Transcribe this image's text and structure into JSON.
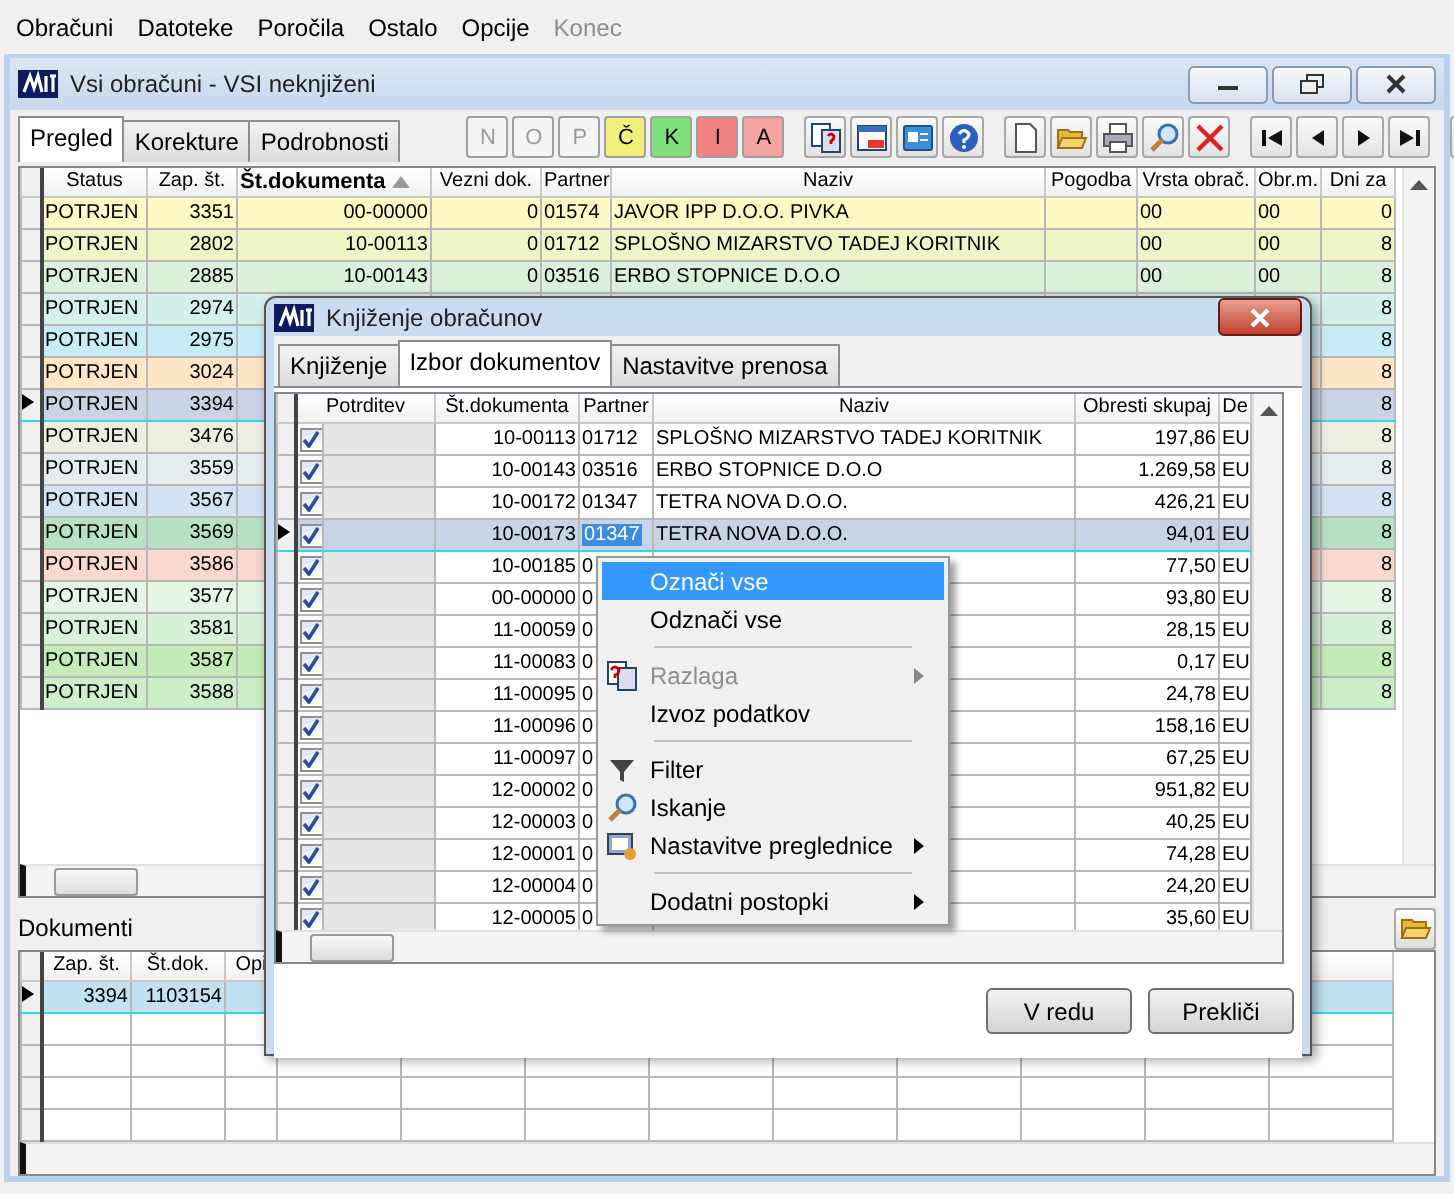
{
  "menubar": [
    {
      "label": "Obračuni",
      "disabled": false
    },
    {
      "label": "Datoteke",
      "disabled": false
    },
    {
      "label": "Poročila",
      "disabled": false
    },
    {
      "label": "Ostalo",
      "disabled": false
    },
    {
      "label": "Opcije",
      "disabled": false
    },
    {
      "label": "Konec",
      "disabled": true
    }
  ],
  "window": {
    "title": "Vsi obračuni - VSI neknjiženi"
  },
  "tabs": [
    {
      "label": "Pregled",
      "selected": true
    },
    {
      "label": "Korekture",
      "selected": false
    },
    {
      "label": "Podrobnosti",
      "selected": false
    }
  ],
  "filter_buttons": [
    {
      "label": "N",
      "disabled": true,
      "color": "#f4f4f4"
    },
    {
      "label": "O",
      "disabled": true,
      "color": "#f4f4f4"
    },
    {
      "label": "P",
      "disabled": true,
      "color": "#f4f4f4"
    },
    {
      "label": "Č",
      "disabled": false,
      "color": "#f2f07a"
    },
    {
      "label": "K",
      "disabled": false,
      "color": "#80e080"
    },
    {
      "label": "I",
      "disabled": false,
      "color": "#f08282"
    },
    {
      "label": "A",
      "disabled": false,
      "color": "#f4a4a0"
    }
  ],
  "grid": {
    "columns": [
      {
        "label": "Status",
        "sorted": false
      },
      {
        "label": "Zap. št.",
        "sorted": false
      },
      {
        "label": "Št.dokumenta",
        "sorted": true
      },
      {
        "label": "Vezni dok.",
        "sorted": false
      },
      {
        "label": "Partner",
        "sorted": false
      },
      {
        "label": "Naziv",
        "sorted": false
      },
      {
        "label": "Pogodba",
        "sorted": false
      },
      {
        "label": "Vrsta obrač.",
        "sorted": false
      },
      {
        "label": "Obr.m.",
        "sorted": false
      },
      {
        "label": "Dni za",
        "sorted": false
      }
    ],
    "rows": [
      {
        "cells": [
          "POTRJEN",
          "3351",
          "00-00000",
          "0",
          "01574",
          "JAVOR IPP  D.O.O. PIVKA",
          "",
          "00",
          "00",
          "0"
        ],
        "color": "#fdf8c4",
        "selected": false
      },
      {
        "cells": [
          "POTRJEN",
          "2802",
          "10-00113",
          "0",
          "01712",
          "SPLOŠNO MIZARSTVO TADEJ KORITNIK",
          "",
          "00",
          "00",
          "8"
        ],
        "color": "#eef6c8",
        "selected": false
      },
      {
        "cells": [
          "POTRJEN",
          "2885",
          "10-00143",
          "0",
          "03516",
          "ERBO STOPNICE D.O.O",
          "",
          "00",
          "00",
          "8"
        ],
        "color": "#daf2da",
        "selected": false
      },
      {
        "cells": [
          "POTRJEN",
          "2974",
          "",
          "",
          "",
          "",
          "",
          "",
          "",
          "8"
        ],
        "color": "#d4f0ea",
        "selected": false
      },
      {
        "cells": [
          "POTRJEN",
          "2975",
          "",
          "",
          "",
          "",
          "",
          "",
          "",
          "8"
        ],
        "color": "#c8ecf6",
        "selected": false
      },
      {
        "cells": [
          "POTRJEN",
          "3024",
          "",
          "",
          "",
          "",
          "",
          "",
          "",
          "8"
        ],
        "color": "#fde6c6",
        "selected": false
      },
      {
        "cells": [
          "POTRJEN",
          "3394",
          "",
          "",
          "",
          "",
          "",
          "",
          "",
          "8"
        ],
        "color": "#c8d4e6",
        "selected": true
      },
      {
        "cells": [
          "POTRJEN",
          "3476",
          "",
          "",
          "",
          "",
          "",
          "",
          "",
          "8"
        ],
        "color": "#eeeee0",
        "selected": false
      },
      {
        "cells": [
          "POTRJEN",
          "3559",
          "",
          "",
          "",
          "",
          "",
          "",
          "",
          "8"
        ],
        "color": "#e4ecee",
        "selected": false
      },
      {
        "cells": [
          "POTRJEN",
          "3567",
          "",
          "",
          "",
          "",
          "",
          "",
          "",
          "8"
        ],
        "color": "#d2e4f4",
        "selected": false
      },
      {
        "cells": [
          "POTRJEN",
          "3569",
          "",
          "",
          "",
          "",
          "",
          "",
          "",
          "8"
        ],
        "color": "#b8e0c2",
        "selected": false
      },
      {
        "cells": [
          "POTRJEN",
          "3586",
          "",
          "",
          "",
          "",
          "",
          "",
          "",
          "8"
        ],
        "color": "#f9d8ce",
        "selected": false
      },
      {
        "cells": [
          "POTRJEN",
          "3577",
          "",
          "",
          "",
          "",
          "",
          "",
          "",
          "8"
        ],
        "color": "#e4f6e4",
        "selected": false
      },
      {
        "cells": [
          "POTRJEN",
          "3581",
          "",
          "",
          "",
          "",
          "",
          "",
          "",
          "8"
        ],
        "color": "#d8f2d8",
        "selected": false
      },
      {
        "cells": [
          "POTRJEN",
          "3587",
          "",
          "",
          "",
          "",
          "",
          "",
          "",
          "8"
        ],
        "color": "#c4ecb8",
        "selected": false
      },
      {
        "cells": [
          "POTRJEN",
          "3588",
          "",
          "",
          "",
          "",
          "",
          "",
          "",
          "8"
        ],
        "color": "#cceec8",
        "selected": false
      }
    ]
  },
  "documents": {
    "title": "Dokumenti",
    "columns": [
      "Zap. št.",
      "Št.dok.",
      "Opi"
    ],
    "rows": [
      {
        "cells": [
          "3394",
          "1103154"
        ],
        "selected": true
      }
    ]
  },
  "dialog": {
    "title": "Knjiženje obračunov",
    "tabs": [
      {
        "label": "Knjiženje",
        "selected": false
      },
      {
        "label": "Izbor dokumentov",
        "selected": true
      },
      {
        "label": "Nastavitve prenosa",
        "selected": false
      }
    ],
    "check_column": "Potrditev",
    "columns": [
      "Št.dokumenta",
      "Partner",
      "Naziv",
      "Obresti skupaj",
      "De"
    ],
    "rows": [
      {
        "checked": true,
        "cells": [
          "10-00113",
          "01712",
          "SPLOŠNO MIZARSTVO TADEJ KORITNIK",
          "197,86",
          "EU"
        ],
        "selected": false
      },
      {
        "checked": true,
        "cells": [
          "10-00143",
          "03516",
          "ERBO STOPNICE D.O.O",
          "1.269,58",
          "EU"
        ],
        "selected": false
      },
      {
        "checked": true,
        "cells": [
          "10-00172",
          "01347",
          "TETRA NOVA D.O.O.",
          "426,21",
          "EU"
        ],
        "selected": false
      },
      {
        "checked": true,
        "cells": [
          "10-00173",
          "01347",
          "TETRA NOVA D.O.O.",
          "94,01",
          "EU"
        ],
        "selected": true
      },
      {
        "checked": true,
        "cells": [
          "10-00185",
          "0",
          "",
          "77,50",
          "EU"
        ],
        "selected": false
      },
      {
        "checked": true,
        "cells": [
          "00-00000",
          "0",
          "",
          "93,80",
          "EU"
        ],
        "selected": false
      },
      {
        "checked": true,
        "cells": [
          "11-00059",
          "0",
          "",
          "28,15",
          "EU"
        ],
        "selected": false
      },
      {
        "checked": true,
        "cells": [
          "11-00083",
          "0",
          "",
          "0,17",
          "EU"
        ],
        "selected": false
      },
      {
        "checked": true,
        "cells": [
          "11-00095",
          "0",
          "",
          "24,78",
          "EU"
        ],
        "selected": false
      },
      {
        "checked": true,
        "cells": [
          "11-00096",
          "0",
          "",
          "158,16",
          "EU"
        ],
        "selected": false
      },
      {
        "checked": true,
        "cells": [
          "11-00097",
          "0",
          "",
          "67,25",
          "EU"
        ],
        "selected": false
      },
      {
        "checked": true,
        "cells": [
          "12-00002",
          "0",
          "",
          "951,82",
          "EU"
        ],
        "selected": false
      },
      {
        "checked": true,
        "cells": [
          "12-00003",
          "0",
          "",
          "40,25",
          "EU"
        ],
        "selected": false
      },
      {
        "checked": true,
        "cells": [
          "12-00001",
          "0",
          "",
          "74,28",
          "EU"
        ],
        "selected": false
      },
      {
        "checked": true,
        "cells": [
          "12-00004",
          "0",
          "",
          "24,20",
          "EU"
        ],
        "selected": false
      },
      {
        "checked": true,
        "cells": [
          "12-00005",
          "0",
          "",
          "35,60",
          "EU"
        ],
        "selected": false
      }
    ],
    "buttons": [
      "V redu",
      "Prekliči"
    ]
  },
  "context_menu": {
    "items": [
      {
        "kind": "item",
        "label": "Označi vse",
        "selected": true,
        "disabled": false,
        "submenu": false
      },
      {
        "kind": "item",
        "label": "Odznači vse",
        "selected": false,
        "disabled": false,
        "submenu": false
      },
      {
        "kind": "separator"
      },
      {
        "kind": "item",
        "label": "Razlaga",
        "selected": false,
        "disabled": true,
        "submenu": true
      },
      {
        "kind": "item",
        "label": "Izvoz podatkov",
        "selected": false,
        "disabled": false,
        "submenu": false
      },
      {
        "kind": "separator"
      },
      {
        "kind": "item",
        "label": "Filter",
        "selected": false,
        "disabled": false,
        "submenu": false
      },
      {
        "kind": "item",
        "label": "Iskanje",
        "selected": false,
        "disabled": false,
        "submenu": false
      },
      {
        "kind": "item",
        "label": "Nastavitve preglednice",
        "selected": false,
        "disabled": false,
        "submenu": true
      },
      {
        "kind": "separator"
      },
      {
        "kind": "item",
        "label": "Dodatni postopki",
        "selected": false,
        "disabled": false,
        "submenu": true
      }
    ]
  }
}
